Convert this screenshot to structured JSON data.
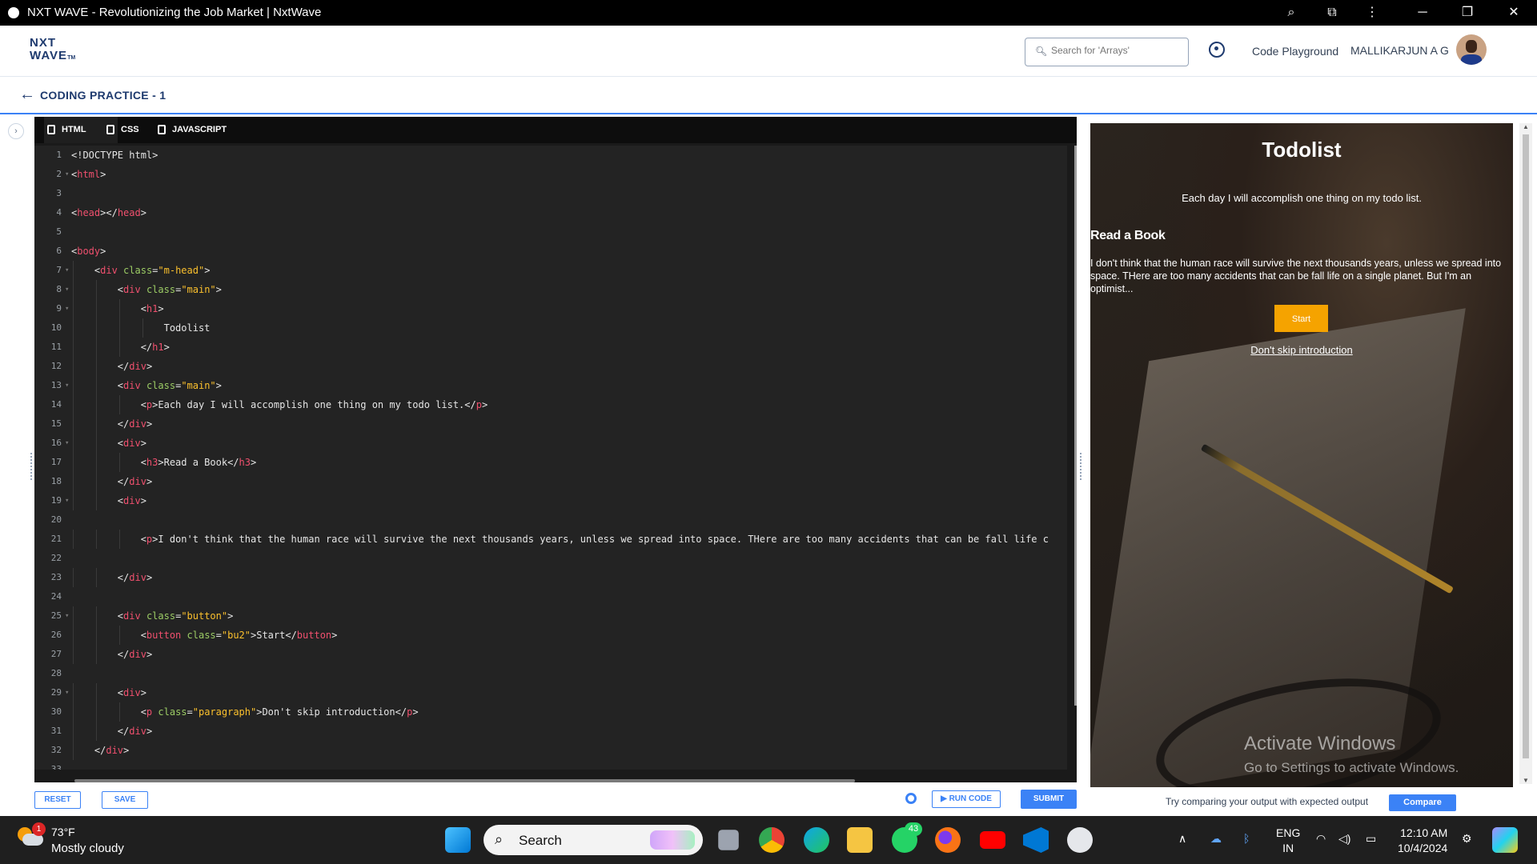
{
  "window": {
    "title": "NXT WAVE - Revolutionizing the Job Market | NxtWave"
  },
  "header": {
    "logo_line1": "NXT",
    "logo_line2": "WAVE",
    "logo_tm": "TM",
    "search_placeholder": "Search for 'Arrays'",
    "playground_label": "Code Playground",
    "user_name": "MALLIKARJUN A G"
  },
  "page": {
    "title": "CODING PRACTICE - 1"
  },
  "editor": {
    "tabs": [
      "HTML",
      "CSS",
      "JAVASCRIPT"
    ],
    "active_tab": "HTML"
  },
  "buttons": {
    "reset": "RESET",
    "save": "SAVE",
    "run_code": "RUN CODE",
    "submit": "SUBMIT",
    "compare": "Compare"
  },
  "compare_text": "Try comparing your output with expected output",
  "preview": {
    "h1": "Todolist",
    "subtitle": "Each day I will accomplish one thing on my todo list.",
    "h3": "Read a Book",
    "paragraph": "I don't think that the human race will survive the next thousands years, unless we spread into space. THere are too many accidents that can be fall life on a single planet. But I'm an optimist...",
    "button": "Start",
    "link": "Don't skip introduction",
    "watermark_title": "Activate Windows",
    "watermark_sub": "Go to Settings to activate Windows."
  },
  "taskbar": {
    "weather_badge": "1",
    "temperature": "73°F",
    "condition": "Mostly cloudy",
    "search": "Search",
    "whatsapp_badge": "43",
    "lang1": "ENG",
    "lang2": "IN",
    "time": "12:10 AM",
    "date": "10/4/2024"
  },
  "code_lines": [
    "<!DOCTYPE html>",
    "<html>",
    "",
    "<head></head>",
    "",
    "<body>",
    "    <div class=\"m-head\">",
    "        <div class=\"main\">",
    "            <h1>",
    "                Todolist",
    "            </h1>",
    "        </div>",
    "        <div class=\"main\">",
    "            <p>Each day I will accomplish one thing on my todo list.</p>",
    "        </div>",
    "        <div>",
    "            <h3>Read a Book</h3>",
    "        </div>",
    "        <div>",
    "",
    "            <p>I don't think that the human race will survive the next thousands years, unless we spread into space. THere are too many accidents that can be fall life c",
    "",
    "        </div>",
    "",
    "        <div class=\"button\">",
    "            <button class=\"bu2\">Start</button>",
    "        </div>",
    "",
    "        <div>",
    "            <p class=\"paragraph\">Don't skip introduction</p>",
    "        </div>",
    "    </div>",
    ""
  ],
  "colors": {
    "accent": "#3b82f6",
    "brand": "#1e3a6e",
    "start_button": "#f5a300",
    "editor_bg": "#232323",
    "tag": "#f0506e",
    "attr": "#9ccc65",
    "string": "#fbc02d"
  }
}
